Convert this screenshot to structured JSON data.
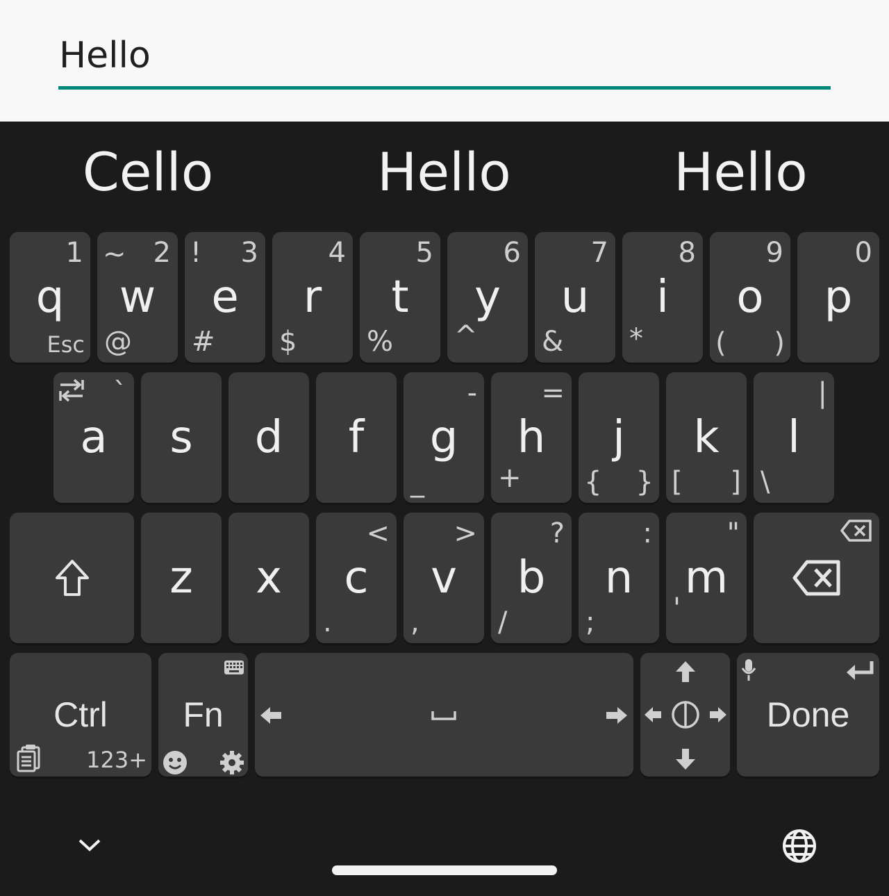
{
  "input": {
    "value": "Hello"
  },
  "suggestions": [
    "Cello",
    "Hello",
    "Hello"
  ],
  "row1": [
    {
      "main": "q",
      "top": "1",
      "bottom": "Esc"
    },
    {
      "main": "w",
      "top": "2",
      "top_left": "~",
      "bottom": "@"
    },
    {
      "main": "e",
      "top": "3",
      "top_left": "!",
      "bottom": "#"
    },
    {
      "main": "r",
      "top": "4",
      "bottom": "$"
    },
    {
      "main": "t",
      "top": "5",
      "bottom": "%"
    },
    {
      "main": "y",
      "top": "6",
      "bottom": "^"
    },
    {
      "main": "u",
      "top": "7",
      "bottom": "&"
    },
    {
      "main": "i",
      "top": "8",
      "bottom": "*"
    },
    {
      "main": "o",
      "top": "9",
      "bottom_left": "(",
      "bottom_right": ")"
    },
    {
      "main": "p",
      "top": "0"
    }
  ],
  "row2": [
    {
      "main": "a",
      "top": "`"
    },
    {
      "main": "s"
    },
    {
      "main": "d"
    },
    {
      "main": "f"
    },
    {
      "main": "g",
      "top": "-",
      "bottom": "_"
    },
    {
      "main": "h",
      "top": "=",
      "bottom": "+"
    },
    {
      "main": "j",
      "bottom_left": "{",
      "bottom_right": "}"
    },
    {
      "main": "k",
      "bottom_left": "[",
      "bottom_right": "]"
    },
    {
      "main": "l",
      "top": "|",
      "bottom": "\\"
    }
  ],
  "row3": [
    {
      "main": "z"
    },
    {
      "main": "x"
    },
    {
      "main": "c",
      "top": "<",
      "bottom": "."
    },
    {
      "main": "v",
      "top": ">",
      "bottom": ","
    },
    {
      "main": "b",
      "top": "?",
      "bottom": "/"
    },
    {
      "main": "n",
      "top": ":",
      "bottom": ";"
    },
    {
      "main": "m",
      "top": "\"",
      "bottom": "'"
    }
  ],
  "row4": {
    "ctrl": "Ctrl",
    "ctrl_sub": "123+",
    "fn": "Fn",
    "done": "Done"
  },
  "icons": {
    "shift": "shift-icon",
    "backspace": "backspace-icon",
    "space": "space-icon",
    "clipboard": "clipboard-icon",
    "emoji": "emoji-icon",
    "settings": "gear-icon",
    "keyboard": "keyboard-icon",
    "mic": "mic-icon",
    "enter": "enter-icon",
    "collapse": "chevron-down-icon",
    "language": "globe-icon"
  },
  "colors": {
    "accent": "#00897b",
    "key_bg": "#3a3a3a",
    "keyboard_bg": "#1b1b1b"
  }
}
